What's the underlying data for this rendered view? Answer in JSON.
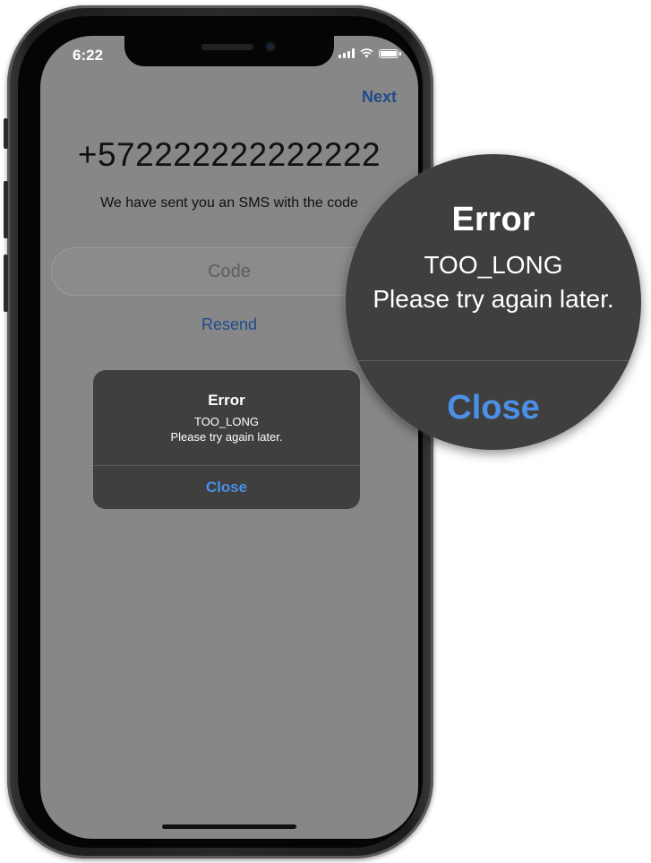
{
  "status_bar": {
    "time": "6:22"
  },
  "nav": {
    "next_label": "Next"
  },
  "verification": {
    "phone_number": "+572222222222222",
    "sms_info": "We have sent you an SMS with the code",
    "code_placeholder": "Code",
    "resend_label": "Resend"
  },
  "alert": {
    "title": "Error",
    "message_line1": "TOO_LONG",
    "message_line2": "Please try again later.",
    "close_label": "Close"
  },
  "zoom_callout": {
    "title": "Error",
    "message_line1": "TOO_LONG",
    "message_line2": "Please try again later.",
    "close_label": "Close"
  },
  "colors": {
    "accent_blue": "#4b8fe6",
    "link_blue": "#1f4b8a",
    "dimmed_background": "#878787",
    "alert_background": "#3f3f3f"
  }
}
